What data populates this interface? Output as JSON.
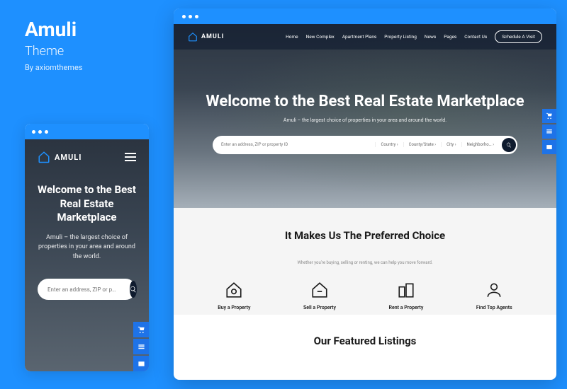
{
  "left": {
    "title": "Amuli",
    "subtitle": "Theme",
    "byline": "By axiomthemes"
  },
  "mobile": {
    "logo": "AMULI",
    "headline": "Welcome to the Best Real Estate Marketplace",
    "sub": "Amuli – the largest choice of properties in your area and around the world.",
    "search_placeholder": "Enter an address, ZIP or p…"
  },
  "desktop": {
    "logo": "AMULI",
    "nav": {
      "home": "Home",
      "new_complex": "New Complex",
      "apartment_plans": "Apartment Plans",
      "property_listing": "Property Listing",
      "news": "News",
      "pages": "Pages",
      "contact": "Contact Us"
    },
    "schedule": "Schedule A Visit",
    "headline": "Welcome to the Best Real Estate Marketplace",
    "sub": "Amuli – the largest choice of properties in your area and around the world.",
    "search": {
      "placeholder": "Enter an address, ZIP or property ID",
      "country": "Country",
      "county_state": "County/State",
      "city": "City",
      "neighborhood": "Neighborho…"
    },
    "section2": {
      "heading": "It Makes Us The Preferred Choice",
      "sub": "Whether you're buying, selling or renting, we can help you move forward.",
      "features": {
        "buy": "Buy a Property",
        "sell": "Sell a Property",
        "rent": "Rent a Property",
        "agents": "Find Top Agents"
      }
    },
    "section3": {
      "heading": "Our Featured Listings"
    }
  }
}
